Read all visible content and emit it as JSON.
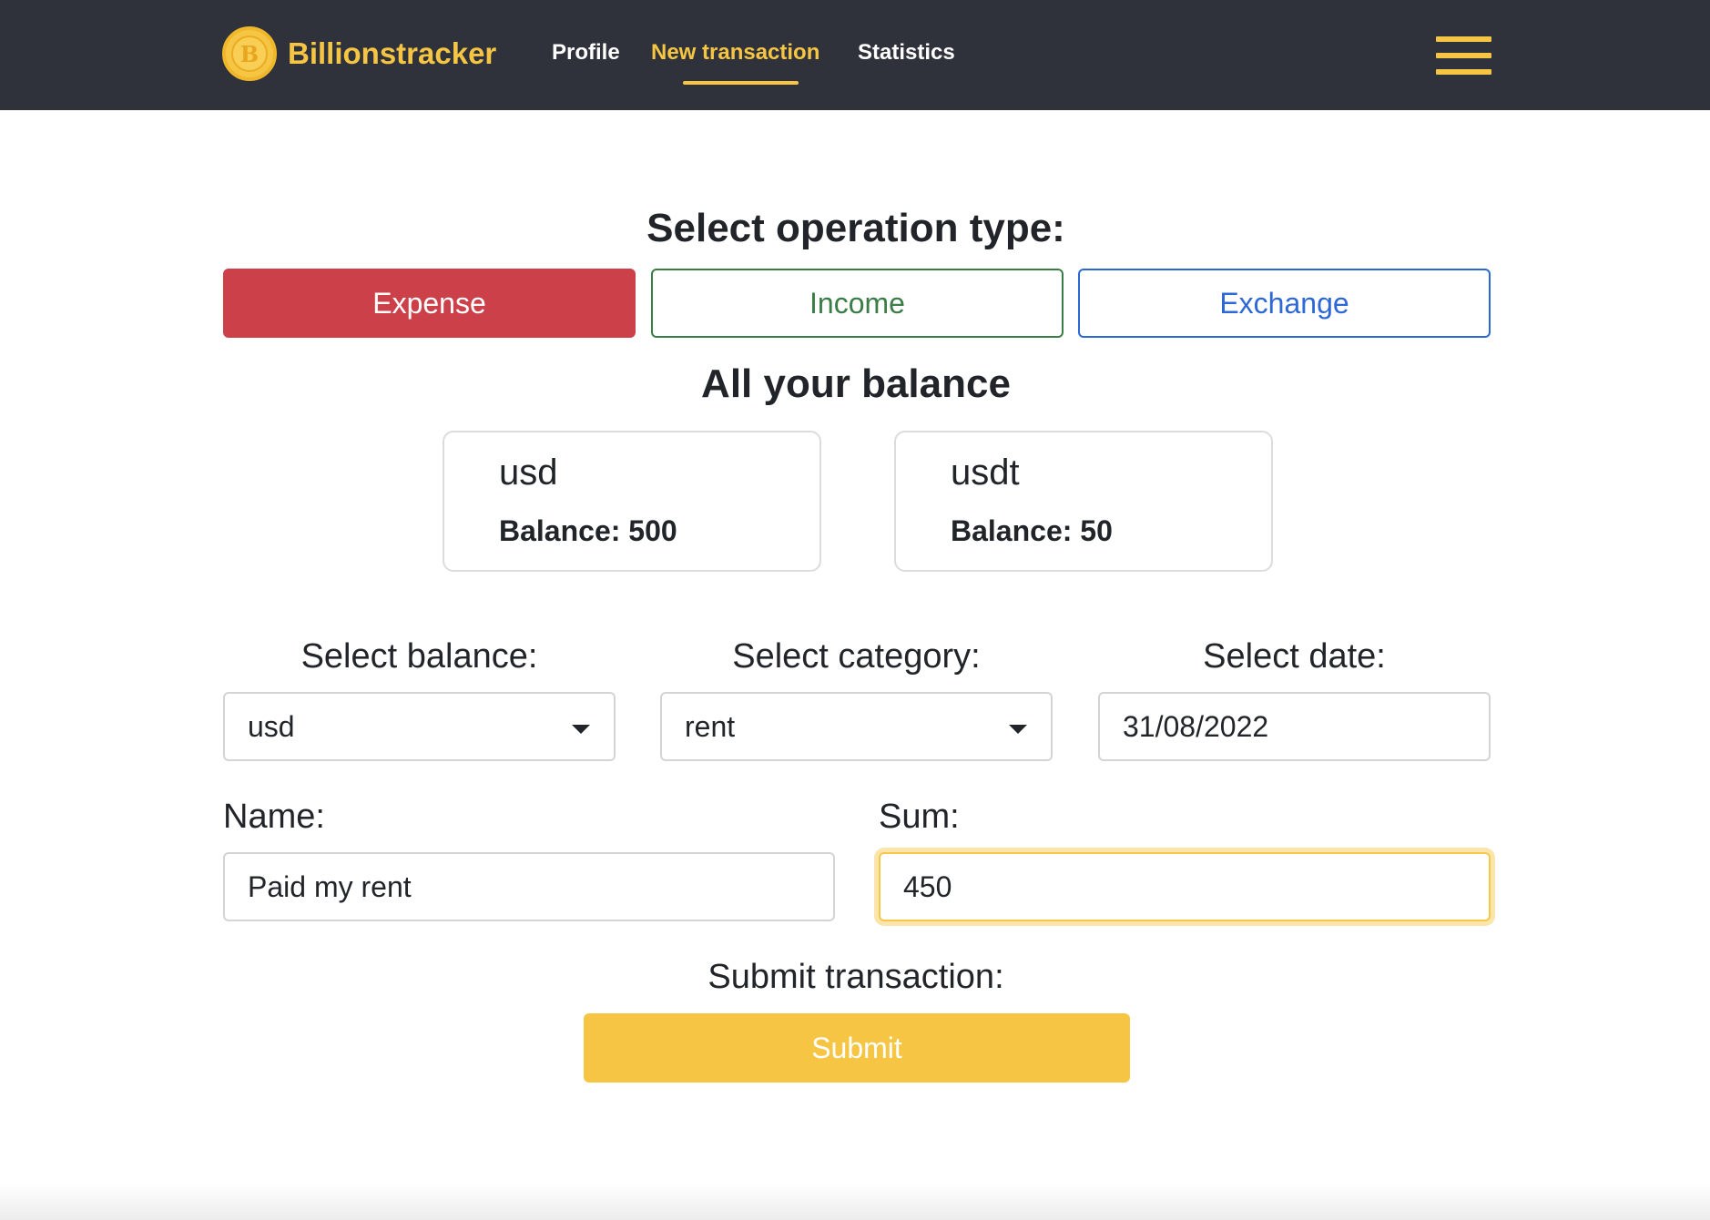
{
  "app": {
    "brand": "Billionstracker",
    "logo_letter": "B"
  },
  "nav": {
    "items": [
      {
        "label": "Profile",
        "active": false
      },
      {
        "label": "New transaction",
        "active": true
      },
      {
        "label": "Statistics",
        "active": false
      }
    ],
    "menu_icon": "hamburger-menu-icon"
  },
  "operation": {
    "heading": "Select operation type:",
    "buttons": [
      {
        "label": "Expense",
        "selected": true,
        "color": "#cc4149"
      },
      {
        "label": "Income",
        "selected": false,
        "color": "#3b7d46"
      },
      {
        "label": "Exchange",
        "selected": false,
        "color": "#2e67d6"
      }
    ]
  },
  "balances": {
    "heading": "All your balance",
    "cards": [
      {
        "currency": "usd",
        "balance_text": "Balance: 500"
      },
      {
        "currency": "usdt",
        "balance_text": "Balance: 50"
      }
    ]
  },
  "form": {
    "balance_label": "Select balance:",
    "balance_value": "usd",
    "category_label": "Select category:",
    "category_value": "rent",
    "date_label": "Select date:",
    "date_value": "31/08/2022",
    "name_label": "Name:",
    "name_value": "Paid my rent",
    "sum_label": "Sum:",
    "sum_value": "450",
    "submit_heading": "Submit transaction:",
    "submit_label": "Submit"
  },
  "colors": {
    "accent": "#f6c544",
    "navbar": "#2f323a"
  }
}
